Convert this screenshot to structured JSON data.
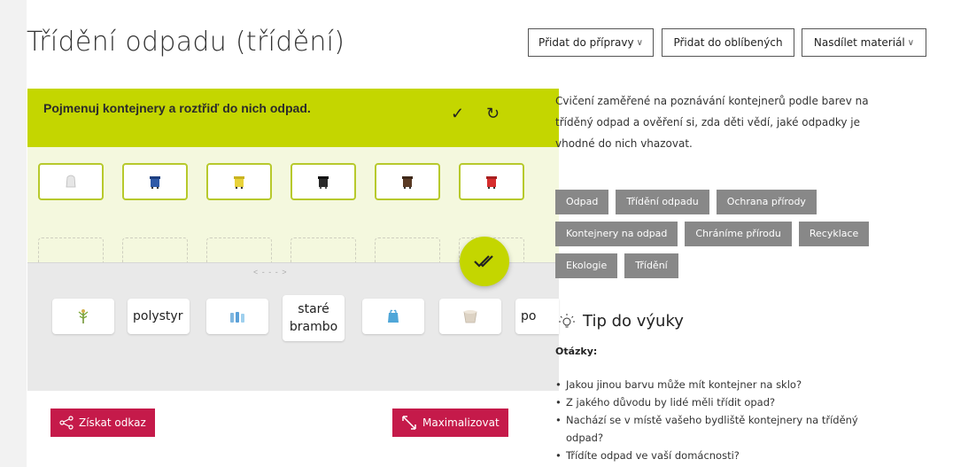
{
  "header": {
    "title": "Třídění odpadu (třídění)",
    "add_to_prep": "Přidat do přípravy",
    "add_to_fav": "Přidat do oblíbených",
    "share": "Nasdílet materiál"
  },
  "exercise": {
    "task": "Pojmenuj kontejnery a roztřiď do nich odpad.",
    "bins": [
      {
        "icon": "white-bin-icon",
        "color": "#e6e6e6"
      },
      {
        "icon": "blue-bin-icon",
        "color": "#2f5aa8"
      },
      {
        "icon": "yellow-bin-icon",
        "color": "#e8d23a"
      },
      {
        "icon": "black-bin-icon",
        "color": "#2a2a2a"
      },
      {
        "icon": "brown-bin-icon",
        "color": "#5a3b25"
      },
      {
        "icon": "red-bin-icon",
        "color": "#d62d2d"
      }
    ],
    "scroll_hint": "< - - - >",
    "items": [
      {
        "type": "icon",
        "icon": "plant-icon"
      },
      {
        "type": "text",
        "text": "polystyr"
      },
      {
        "type": "icon",
        "icon": "bottles-icon"
      },
      {
        "type": "text2",
        "line1": "staré",
        "line2": "brambo"
      },
      {
        "type": "icon",
        "icon": "plastic-bag-icon"
      },
      {
        "type": "icon",
        "icon": "bucket-icon"
      },
      {
        "type": "text",
        "text": "po"
      }
    ],
    "get_link": "Získat odkaz",
    "maximize": "Maximalizovat"
  },
  "sidebar": {
    "description": "Cvičení zaměřené na poznávání kontejnerů podle barev na tříděný odpad a ověření si, zda děti vědí, jaké odpadky je vhodné do nich vhazovat.",
    "tags": [
      "Odpad",
      "Třídění odpadu",
      "Ochrana přírody",
      "Kontejnery na odpad",
      "Chráníme přírodu",
      "Recyklace",
      "Ekologie",
      "Třídění"
    ],
    "tip_title": "Tip do výuky",
    "questions_label": "Otázky:",
    "questions": [
      "Jakou jinou barvu může mít kontejner na sklo?",
      "Z jakého důvodu by lidé měli třídit opad?",
      "Nachází se v místě vašeho bydliště kontejnery na tříděný odpad?",
      "Třídíte odpad ve vaší domácnosti?"
    ]
  },
  "colors": {
    "accent_green": "#c4d600",
    "brand_red": "#c51a4a",
    "tag_gray": "#888888"
  }
}
